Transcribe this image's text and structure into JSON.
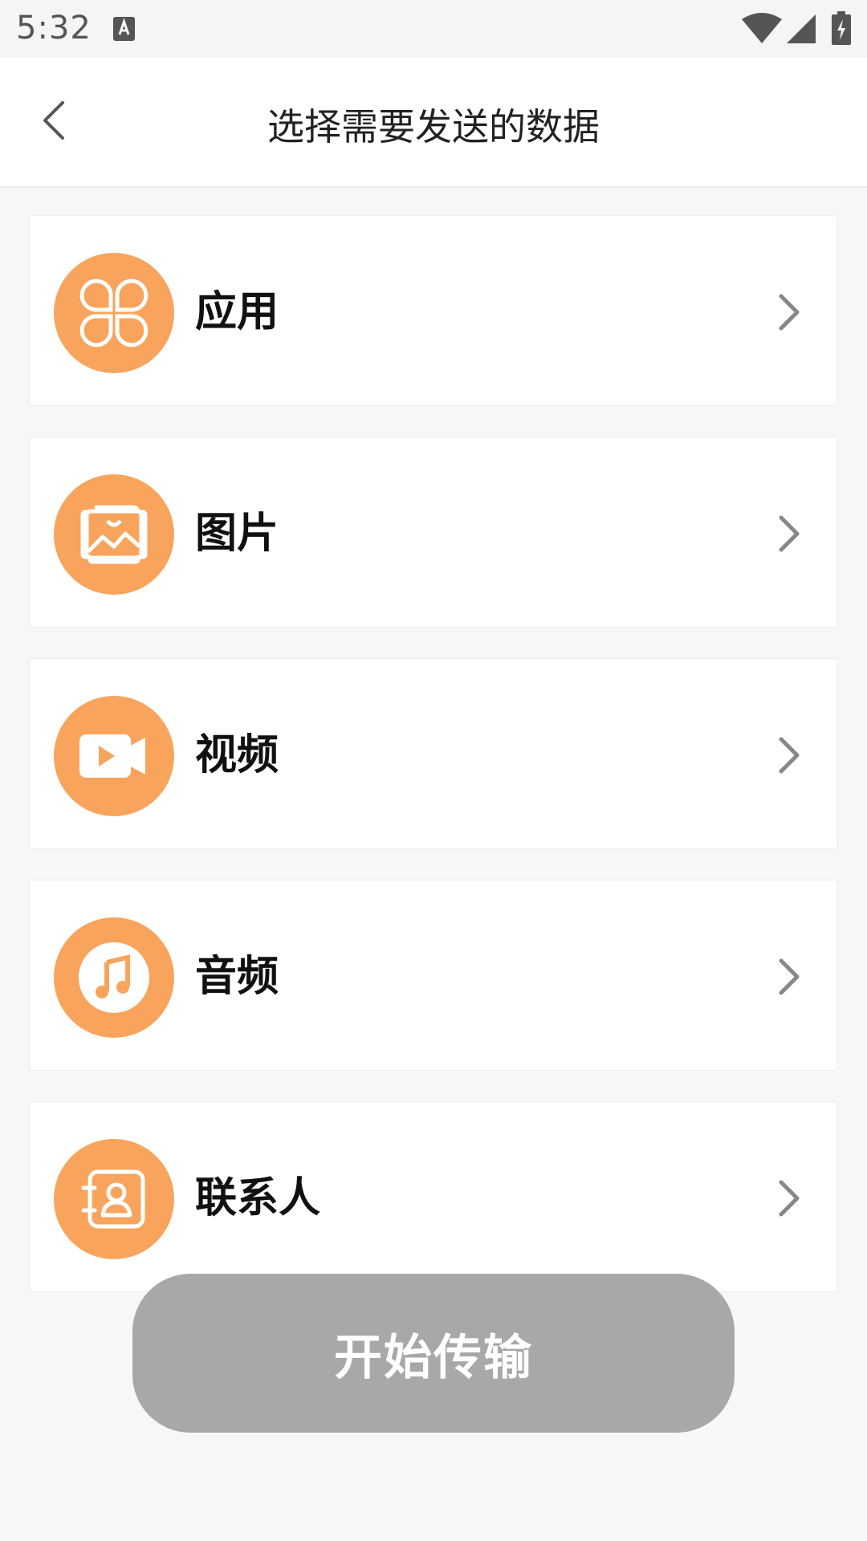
{
  "status_bar": {
    "time": "5:32",
    "icons": [
      "keyboard-a-icon",
      "wifi-icon",
      "cell-signal-icon",
      "battery-charging-icon"
    ]
  },
  "header": {
    "title": "选择需要发送的数据",
    "back_icon": "chevron-left-icon"
  },
  "items": [
    {
      "label": "应用",
      "icon": "apps-clover-icon"
    },
    {
      "label": "图片",
      "icon": "image-icon"
    },
    {
      "label": "视频",
      "icon": "video-camera-icon"
    },
    {
      "label": "音频",
      "icon": "music-note-icon"
    },
    {
      "label": "联系人",
      "icon": "contact-book-icon"
    }
  ],
  "start_button": {
    "label": "开始传输"
  },
  "colors": {
    "accent": "#f8a45c",
    "button_disabled": "#a8a8a8",
    "background": "#f7f7f7"
  }
}
